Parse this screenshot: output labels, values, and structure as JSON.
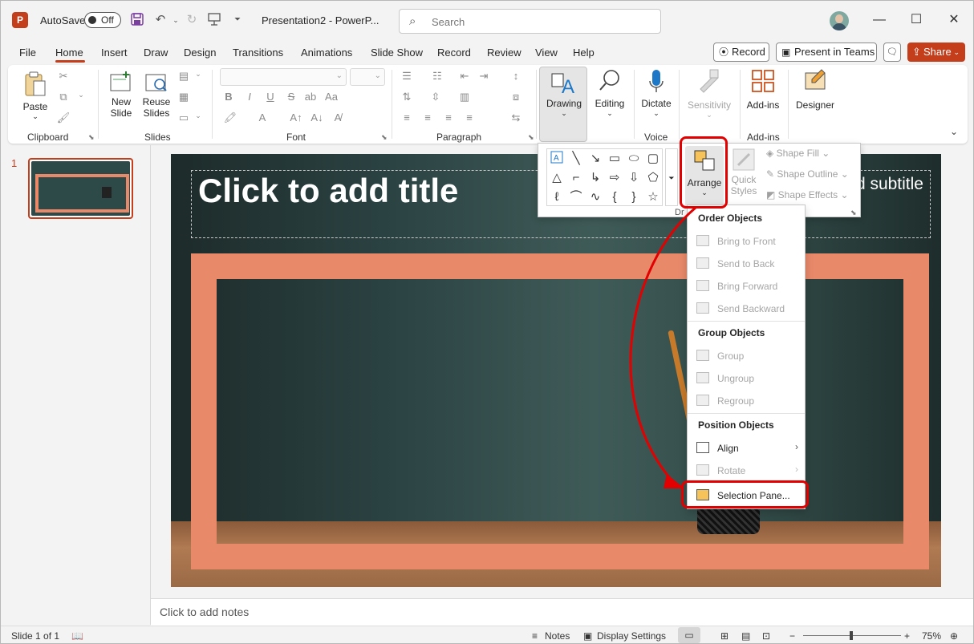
{
  "titlebar": {
    "app_logo": "P",
    "autosave_label": "AutoSave",
    "autosave_state": "Off",
    "doc_title": "Presentation2 - PowerP...",
    "search_placeholder": "Search"
  },
  "tabs": [
    "File",
    "Home",
    "Insert",
    "Draw",
    "Design",
    "Transitions",
    "Animations",
    "Slide Show",
    "Record",
    "Review",
    "View",
    "Help"
  ],
  "active_tab": "Home",
  "header_buttons": {
    "record": "Record",
    "present": "Present in Teams",
    "share": "Share"
  },
  "ribbon": {
    "clipboard": {
      "label": "Clipboard",
      "paste": "Paste"
    },
    "slides": {
      "label": "Slides",
      "new_slide_1": "New",
      "new_slide_2": "Slide",
      "reuse_1": "Reuse",
      "reuse_2": "Slides"
    },
    "font": {
      "label": "Font"
    },
    "paragraph": {
      "label": "Paragraph"
    },
    "drawing": {
      "label": "Drawing"
    },
    "editing": {
      "label": "Editing"
    },
    "voice": {
      "label": "Voice",
      "dictate": "Dictate"
    },
    "sensitivity": {
      "label": "Sensitivity",
      "button": "Sensitivity"
    },
    "addins": {
      "label": "Add-ins",
      "button": "Add-ins"
    },
    "designer": {
      "button": "Designer"
    }
  },
  "drawing_panel": {
    "arrange": "Arrange",
    "quick_styles_1": "Quick",
    "quick_styles_2": "Styles",
    "shape_fill": "Shape Fill",
    "shape_outline": "Shape Outline",
    "shape_effects": "Shape Effects",
    "group_label_partial": "Dr"
  },
  "arrange_menu": {
    "order_header": "Order Objects",
    "bring_to_front": "Bring to Front",
    "send_to_back": "Send to Back",
    "bring_forward": "Bring Forward",
    "send_backward": "Send Backward",
    "group_header": "Group Objects",
    "group": "Group",
    "ungroup": "Ungroup",
    "regroup": "Regroup",
    "position_header": "Position Objects",
    "align": "Align",
    "rotate": "Rotate",
    "selection_pane": "Selection Pane..."
  },
  "slide": {
    "number": "1",
    "title_placeholder": "Click to add title",
    "subtitle_placeholder_partial": "d subtitle"
  },
  "notes_placeholder": "Click to add notes",
  "status": {
    "slide_info": "Slide 1 of 1",
    "notes": "Notes",
    "display_settings": "Display Settings",
    "zoom": "75%"
  },
  "colors": {
    "accent": "#c43e1c",
    "highlight": "#e30000",
    "frame_orange": "#e8896a"
  }
}
